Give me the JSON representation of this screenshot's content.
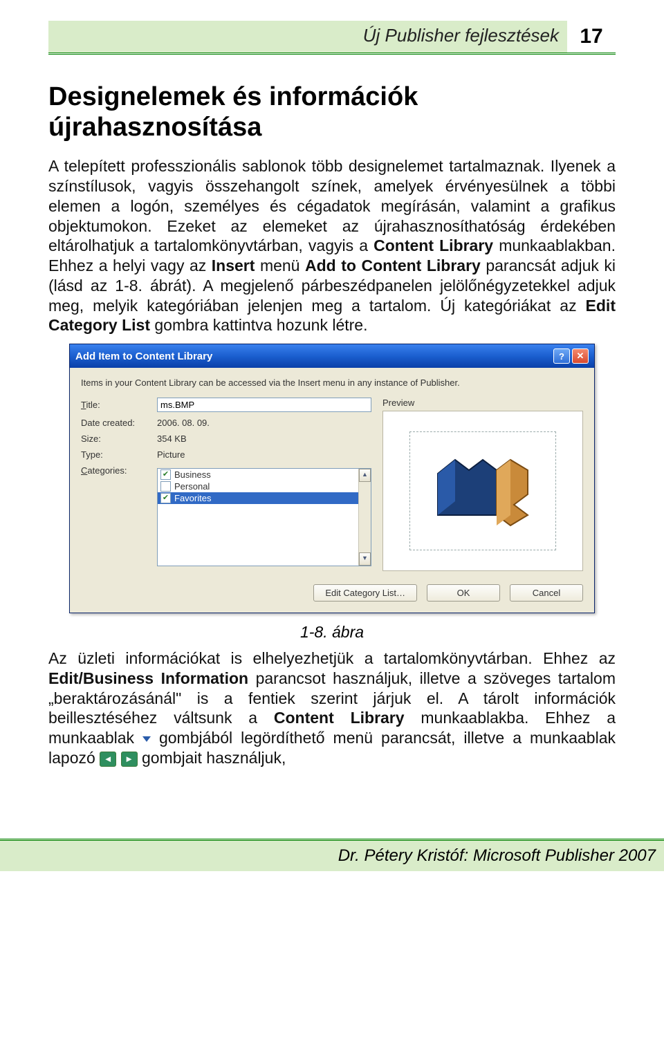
{
  "header": {
    "title": "Új Publisher fejlesztések",
    "page_number": "17"
  },
  "section_heading": "Designelemek és információk újrahasznosítása",
  "para1_parts": [
    "A telepített professzionális sablonok több designelemet tartalmaznak. Ilyenek a színstílusok, vagyis összehangolt színek, amelyek érvényesülnek a többi elemen a logón, személyes és cégadatok megírásán, valamint a grafikus objektumokon. Ezeket az elemeket az újrahasznosíthatóság érdekében eltárolhatjuk a tartalomkönyvtárban, vagyis a ",
    "Content Library",
    " munkaablakban. Ehhez a helyi vagy az ",
    "Insert",
    " menü ",
    "Add to Content Library",
    " parancsát adjuk ki (lásd az 1-8. ábrát). A megjelenő párbeszédpanelen jelölőnégyzetekkel adjuk meg, melyik kategóriában jelenjen meg a tartalom. Új kategóriákat az ",
    "Edit Category List",
    " gombra kattintva hozunk létre."
  ],
  "dialog": {
    "title": "Add Item to Content Library",
    "info": "Items in your Content Library can be accessed via the Insert menu in any instance of Publisher.",
    "labels": {
      "title": "Title:",
      "date": "Date created:",
      "size": "Size:",
      "type": "Type:",
      "categories": "Categories:",
      "preview": "Preview"
    },
    "values": {
      "title": "ms.BMP",
      "date": "2006. 08. 09.",
      "size": "354 KB",
      "type": "Picture"
    },
    "categories": [
      {
        "label": "Business",
        "checked": true,
        "selected": false
      },
      {
        "label": "Personal",
        "checked": false,
        "selected": false
      },
      {
        "label": "Favorites",
        "checked": true,
        "selected": true
      }
    ],
    "buttons": {
      "edit": "Edit Category List…",
      "ok": "OK",
      "cancel": "Cancel"
    }
  },
  "figure_caption": "1-8. ábra",
  "para2_parts": [
    "Az üzleti információkat is elhelyezhetjük a tartalomkönyvtárban. Ehhez az ",
    "Edit/Business Information",
    " parancsot használjuk, illetve a szöveges tartalom „beraktározásánál\" is a fentiek szerint járjuk el. A tárolt információk beillesztéséhez váltsunk a ",
    "Content Library",
    " munkaablakba. Ehhez a munkaablak ",
    " gombjából legördíthető menü parancsát, illetve a munkaablak lapozó ",
    " gombjait használjuk,"
  ],
  "footer": "Dr. Pétery Kristóf: Microsoft Publisher 2007"
}
